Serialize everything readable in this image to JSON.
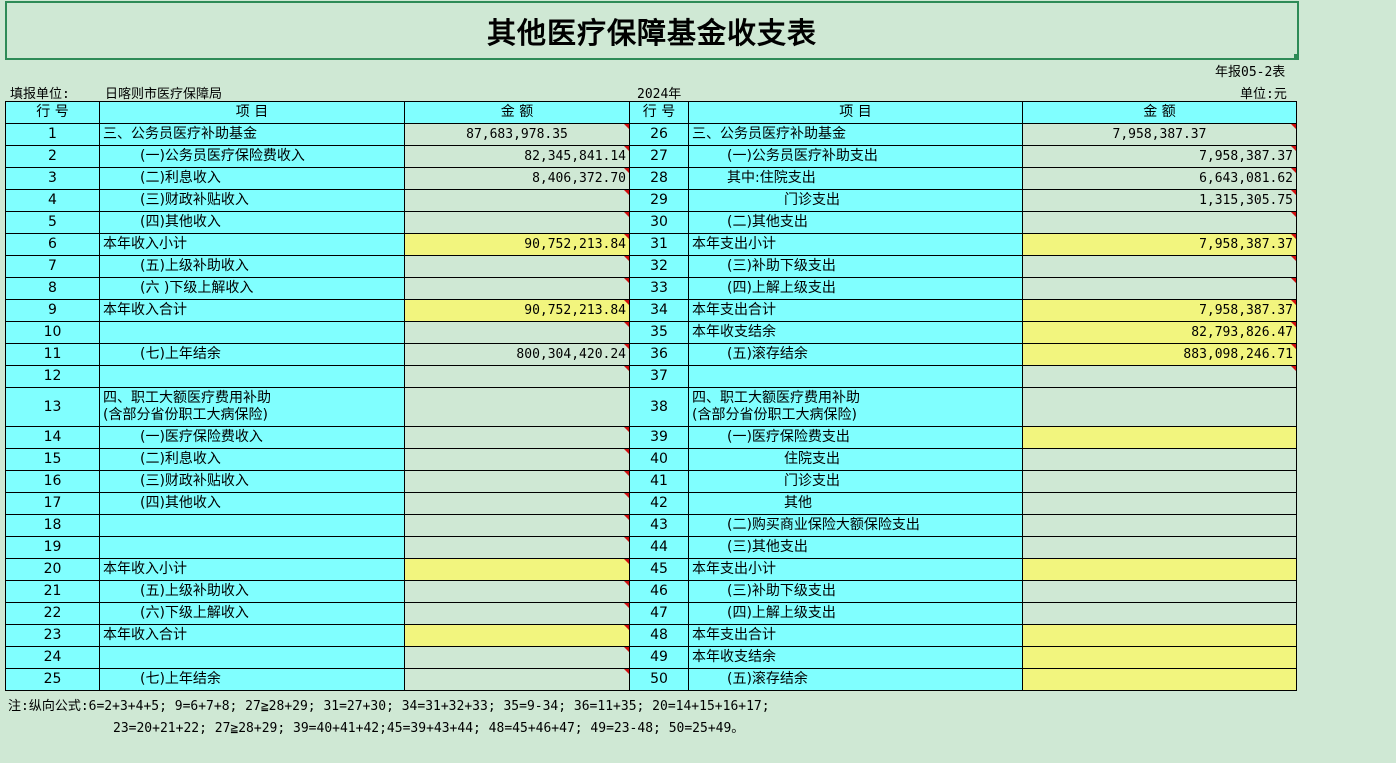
{
  "title": "其他医疗保障基金收支表",
  "form_code": "年报05-2表",
  "unit_label": "填报单位:",
  "unit_name": "日喀则市医疗保障局",
  "year": "2024年",
  "currency": "单位:元",
  "headers": {
    "line_no": "行  号",
    "item": "项        目",
    "amount": "金        额"
  },
  "left_rows": [
    {
      "no": "1",
      "item": "三、公务员医疗补助基金",
      "amount": "87,683,978.35"
    },
    {
      "no": "2",
      "item": "(一)公务员医疗保险费收入",
      "amount": "82,345,841.14"
    },
    {
      "no": "3",
      "item": "(二)利息收入",
      "amount": "8,406,372.70"
    },
    {
      "no": "4",
      "item": "(三)财政补贴收入",
      "amount": ""
    },
    {
      "no": "5",
      "item": "(四)其他收入",
      "amount": ""
    },
    {
      "no": "6",
      "item": "本年收入小计",
      "amount": "90,752,213.84"
    },
    {
      "no": "7",
      "item": "(五)上级补助收入",
      "amount": ""
    },
    {
      "no": "8",
      "item": "(六 )下级上解收入",
      "amount": ""
    },
    {
      "no": "9",
      "item": "本年收入合计",
      "amount": "90,752,213.84"
    },
    {
      "no": "10",
      "item": "",
      "amount": ""
    },
    {
      "no": "11",
      "item": "(七)上年结余",
      "amount": "800,304,420.24"
    },
    {
      "no": "12",
      "item": "",
      "amount": ""
    },
    {
      "no": "13",
      "item": "四、职工大额医疗费用补助\n(含部分省份职工大病保险)",
      "amount": ""
    },
    {
      "no": "14",
      "item": "(一)医疗保险费收入",
      "amount": ""
    },
    {
      "no": "15",
      "item": "(二)利息收入",
      "amount": ""
    },
    {
      "no": "16",
      "item": "(三)财政补贴收入",
      "amount": ""
    },
    {
      "no": "17",
      "item": "(四)其他收入",
      "amount": ""
    },
    {
      "no": "18",
      "item": "",
      "amount": ""
    },
    {
      "no": "19",
      "item": "",
      "amount": ""
    },
    {
      "no": "20",
      "item": "本年收入小计",
      "amount": ""
    },
    {
      "no": "21",
      "item": "(五)上级补助收入",
      "amount": ""
    },
    {
      "no": "22",
      "item": "(六)下级上解收入",
      "amount": ""
    },
    {
      "no": "23",
      "item": "本年收入合计",
      "amount": ""
    },
    {
      "no": "24",
      "item": "",
      "amount": ""
    },
    {
      "no": "25",
      "item": "(七)上年结余",
      "amount": ""
    }
  ],
  "right_rows": [
    {
      "no": "26",
      "item": "三、公务员医疗补助基金",
      "amount": "7,958,387.37"
    },
    {
      "no": "27",
      "item": "(一)公务员医疗补助支出",
      "amount": "7,958,387.37"
    },
    {
      "no": "28",
      "item": "其中:住院支出",
      "amount": "6,643,081.62"
    },
    {
      "no": "29",
      "item": "门诊支出",
      "amount": "1,315,305.75"
    },
    {
      "no": "30",
      "item": "(二)其他支出",
      "amount": ""
    },
    {
      "no": "31",
      "item": "本年支出小计",
      "amount": "7,958,387.37"
    },
    {
      "no": "32",
      "item": "(三)补助下级支出",
      "amount": ""
    },
    {
      "no": "33",
      "item": "(四)上解上级支出",
      "amount": ""
    },
    {
      "no": "34",
      "item": "本年支出合计",
      "amount": "7,958,387.37"
    },
    {
      "no": "35",
      "item": "本年收支结余",
      "amount": "82,793,826.47"
    },
    {
      "no": "36",
      "item": "(五)滚存结余",
      "amount": "883,098,246.71"
    },
    {
      "no": "37",
      "item": "",
      "amount": ""
    },
    {
      "no": "38",
      "item": "四、职工大额医疗费用补助\n(含部分省份职工大病保险)",
      "amount": ""
    },
    {
      "no": "39",
      "item": "(一)医疗保险费支出",
      "amount": ""
    },
    {
      "no": "40",
      "item": "住院支出",
      "amount": ""
    },
    {
      "no": "41",
      "item": "门诊支出",
      "amount": ""
    },
    {
      "no": "42",
      "item": "其他",
      "amount": ""
    },
    {
      "no": "43",
      "item": "(二)购买商业保险大额保险支出",
      "amount": ""
    },
    {
      "no": "44",
      "item": "(三)其他支出",
      "amount": ""
    },
    {
      "no": "45",
      "item": "本年支出小计",
      "amount": ""
    },
    {
      "no": "46",
      "item": "(三)补助下级支出",
      "amount": ""
    },
    {
      "no": "47",
      "item": "(四)上解上级支出",
      "amount": ""
    },
    {
      "no": "48",
      "item": "本年支出合计",
      "amount": ""
    },
    {
      "no": "49",
      "item": "本年收支结余",
      "amount": ""
    },
    {
      "no": "50",
      "item": "(五)滚存结余",
      "amount": ""
    }
  ],
  "notes": {
    "line1": "注:纵向公式:6=2+3+4+5; 9=6+7+8; 27≧28+29; 31=27+30; 34=31+32+33; 35=9-34; 36=11+35; 20=14+15+16+17;",
    "line2": "23=20+21+22; 27≧28+29; 39=40+41+42;45=39+43+44; 48=45+46+47; 49=23-48; 50=25+49。"
  }
}
